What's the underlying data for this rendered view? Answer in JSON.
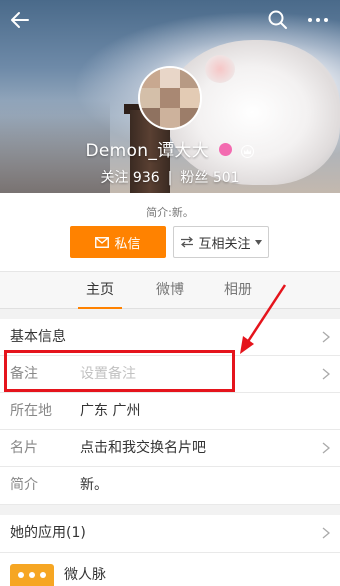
{
  "header": {
    "back_icon": "arrow-left-icon",
    "search_icon": "search-icon",
    "more_icon": "more-horizontal-icon"
  },
  "profile": {
    "name": "Demon_谭大大",
    "follow_label": "关注",
    "follow_count": "936",
    "fans_label": "粉丝",
    "fans_count": "501",
    "separator": "|",
    "intro_text": "简介:新。"
  },
  "actions": {
    "message_label": "私信",
    "mutual_follow_label": "互相关注"
  },
  "tabs": [
    {
      "label": "主页",
      "active": true
    },
    {
      "label": "微博",
      "active": false
    },
    {
      "label": "相册",
      "active": false
    }
  ],
  "info": {
    "basic_info_label": "基本信息",
    "remark_label": "备注",
    "remark_placeholder": "设置备注",
    "location_label": "所在地",
    "location_value": "广东 广州",
    "card_label": "名片",
    "card_value": "点击和我交换名片吧",
    "intro_label": "简介",
    "intro_value": "新。"
  },
  "apps": {
    "title": "她的应用(1)",
    "items": [
      {
        "name": "微人脉"
      }
    ]
  },
  "colors": {
    "accent": "#ff8200",
    "highlight": "#e5141c"
  }
}
